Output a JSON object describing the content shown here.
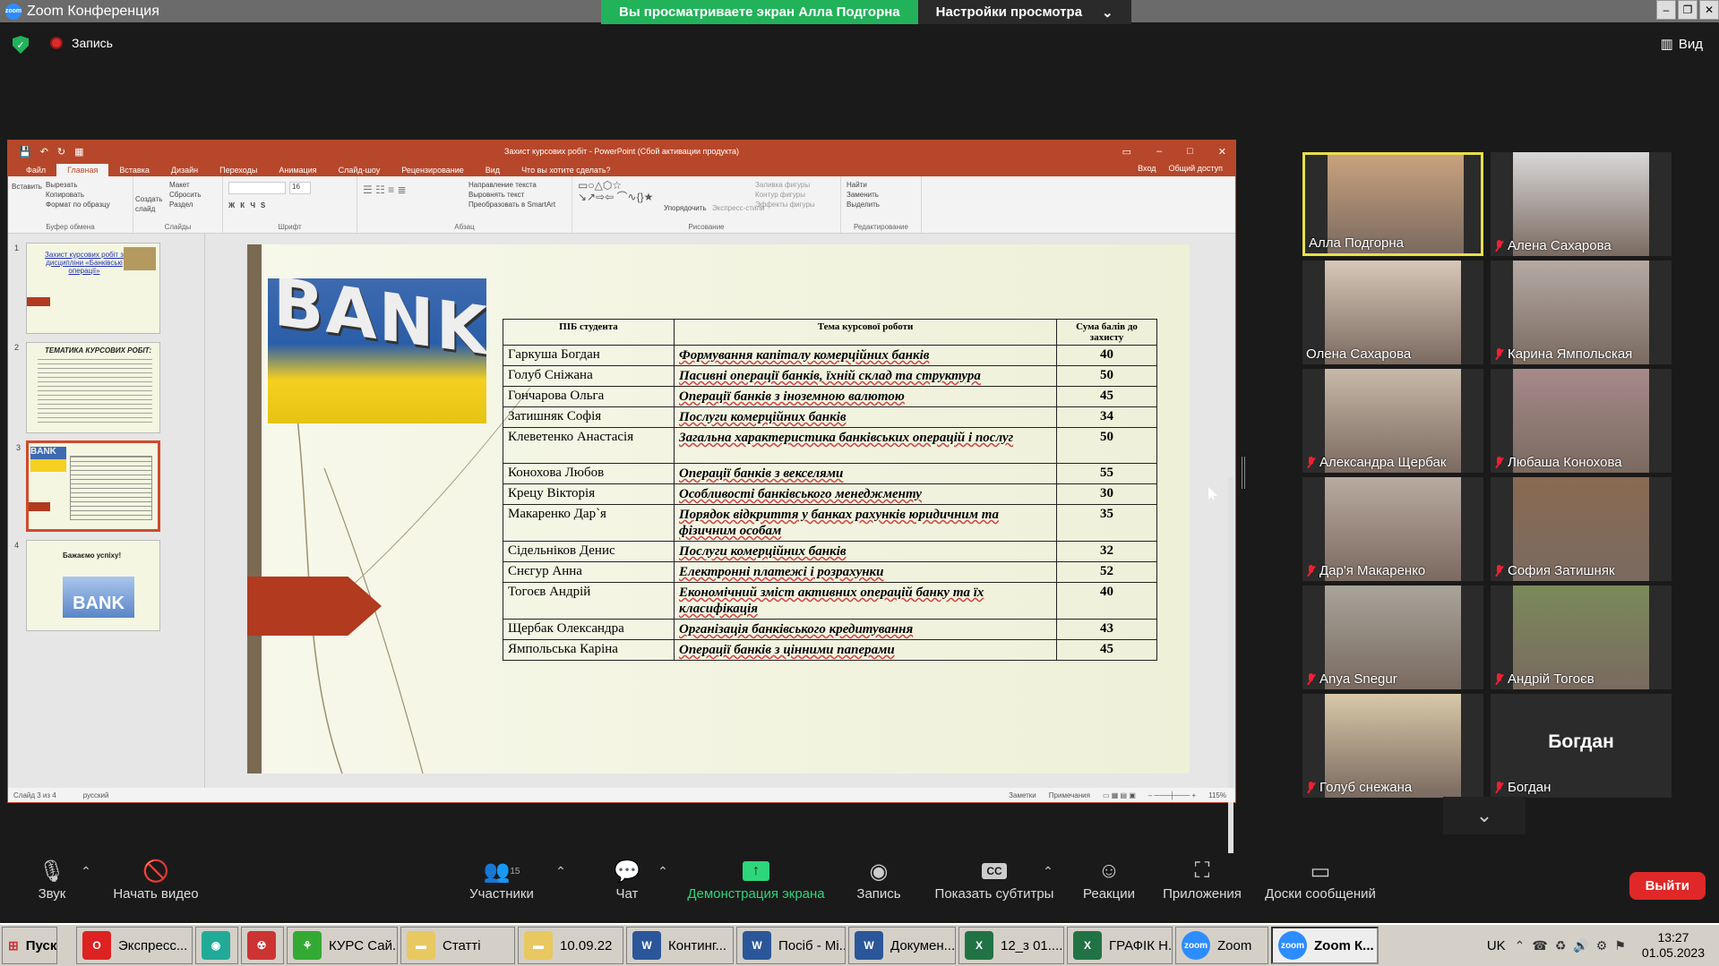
{
  "window": {
    "title": "Zoom Конференция"
  },
  "banner": {
    "viewing": "Вы просматриваете экран Алла Подгорна",
    "options": "Настройки просмотра"
  },
  "topbar": {
    "record": "Запись",
    "view": "Вид"
  },
  "ppt": {
    "title": "Захист курсових робіт - PowerPoint (Сбой активации продукта)",
    "tabs": [
      "Файл",
      "Главная",
      "Вставка",
      "Дизайн",
      "Переходы",
      "Анимация",
      "Слайд-шоу",
      "Рецензирование",
      "Вид",
      "Что вы хотите сделать?"
    ],
    "login": "Вход",
    "share": "Общий доступ",
    "ribbon": {
      "clipboard": {
        "paste": "Вставить",
        "cut": "Вырезать",
        "copy": "Копировать",
        "format": "Формат по образцу",
        "label": "Буфер обмена"
      },
      "slides": {
        "create": "Создать слайд",
        "layout": "Макет",
        "reset": "Сбросить",
        "section": "Раздел",
        "label": "Слайды"
      },
      "font": {
        "label": "Шрифт",
        "size": "16"
      },
      "paragraph": {
        "dir": "Направление текста",
        "align": "Выровнять текст",
        "smartart": "Преобразовать в SmartArt",
        "label": "Абзац"
      },
      "drawing": {
        "arrange": "Упорядочить",
        "styles": "Экспресс-стили",
        "fill": "Заливка фигуры",
        "outline": "Контур фигуры",
        "effects": "Эффекты фигуры",
        "label": "Рисование"
      },
      "editing": {
        "find": "Найти",
        "replace": "Заменить",
        "select": "Выделить",
        "label": "Редактирование"
      }
    },
    "thumbs": [
      {
        "num": "1",
        "text": "Захист курсових робіт з дисципліни «Банківські операції»"
      },
      {
        "num": "2",
        "text": "ТЕМАТИКА КУРСОВИХ РОБІТ:"
      },
      {
        "num": "3",
        "text": "BANK"
      },
      {
        "num": "4",
        "text": "Бажаємо успіху!"
      }
    ],
    "slide": {
      "bank_text": "BANK",
      "headers": [
        "ПІБ студента",
        "Тема курсової роботи",
        "Сума балів до захисту"
      ],
      "rows": [
        {
          "name": "Гаркуша Богдан",
          "topic": "Формування капіталу комерційних банків",
          "score": "40"
        },
        {
          "name": "Голуб Сніжана",
          "topic": "Пасивні операції банків, їхній склад та структура",
          "score": "50"
        },
        {
          "name": "Гончарова Ольга",
          "topic": "Операції банків з іноземною валютою",
          "score": "45"
        },
        {
          "name": "Затишняк Софія",
          "topic": "Послуги комерційних банків",
          "score": "34"
        },
        {
          "name": "Клеветенко Анастасія",
          "topic": "Загальна характеристика банківських операцій і послуг",
          "score": "50"
        },
        {
          "name": "Конохова Любов",
          "topic": "Операції банків з векселями",
          "score": "55"
        },
        {
          "name": "Крецу Вікторія",
          "topic": "Особливості банківського менеджменту",
          "score": "30"
        },
        {
          "name": "Макаренко Дар`я",
          "topic": "Порядок відкриття у банках рахунків юридичним та фізичним особам",
          "score": "35"
        },
        {
          "name": "Сідельніков Денис",
          "topic": "Послуги комерційних банків",
          "score": "32"
        },
        {
          "name": "Снєгур Анна",
          "topic": "Електронні платежі і розрахунки",
          "score": "52"
        },
        {
          "name": "Тогоєв Андрій",
          "topic": "Економічний зміст активних операцій банку та їх класифікація",
          "score": "40"
        },
        {
          "name": "Щербак Олександра",
          "topic": "Організація банківського кредитування",
          "score": "43"
        },
        {
          "name": "Ямпольська Каріна",
          "topic": "Операції банків з цінними паперами",
          "score": "45"
        }
      ]
    },
    "status": {
      "slide": "Слайд 3 из 4",
      "lang": "русский",
      "notes": "Заметки",
      "comments": "Примечания",
      "zoom": "115%"
    }
  },
  "participants": [
    {
      "name": "Алла Подгорна",
      "muted": false,
      "active": true,
      "color": "#c9a27e"
    },
    {
      "name": "Алена Сахарова",
      "muted": true,
      "color": "#d8d8d8"
    },
    {
      "name": "Олена Сахарова",
      "muted": false,
      "color": "#d6c7b8"
    },
    {
      "name": "Карина Ямпольская",
      "muted": true,
      "color": "#b5aaa4"
    },
    {
      "name": "Александра Щербак",
      "muted": true,
      "color": "#c8b8a8"
    },
    {
      "name": "Любаша  Конохова",
      "muted": true,
      "color": "#a68a8a"
    },
    {
      "name": "Дар'я Макаренко",
      "muted": true,
      "color": "#b9aaa0"
    },
    {
      "name": "София Затишняк",
      "muted": true,
      "color": "#8a6a52"
    },
    {
      "name": "Anya Snegur",
      "muted": true,
      "color": "#a8a49a"
    },
    {
      "name": "Андрій Тогоєв",
      "muted": true,
      "color": "#7a8a5a"
    },
    {
      "name": "Голуб снежана",
      "muted": true,
      "color": "#d8c8a8"
    },
    {
      "name": "Богдан",
      "muted": true,
      "big": "Богдан",
      "color": "#2b2b2b"
    }
  ],
  "toolbar": {
    "audio": "Звук",
    "video": "Начать видео",
    "participants": "Участники",
    "participants_count": "15",
    "chat": "Чат",
    "share": "Демонстрация экрана",
    "record": "Запись",
    "captions": "Показать субтитры",
    "reactions": "Реакции",
    "apps": "Приложения",
    "whiteboards": "Доски сообщений",
    "exit": "Выйти"
  },
  "taskbar": {
    "start": "Пуск",
    "items": [
      "Экспресс...",
      "",
      "",
      "КУРС Сай...",
      "Статті",
      "10.09.22",
      "Континг...",
      "Посіб - Мі...",
      "Докумен...",
      "12_з 01....",
      "ГРАФІК Н...",
      "Zoom",
      "Zoom К..."
    ],
    "lang": "UK",
    "time": "13:27",
    "date": "01.05.2023"
  }
}
